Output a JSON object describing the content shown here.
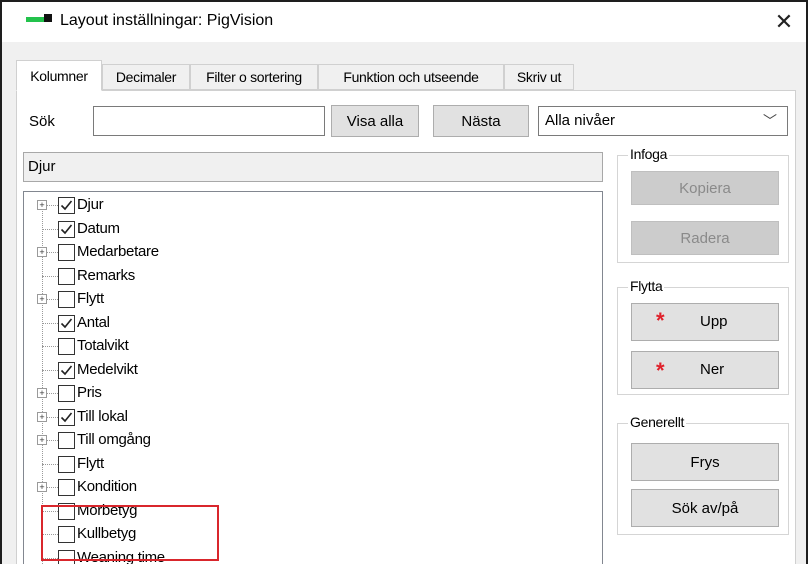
{
  "window": {
    "title": "Layout inställningar: PigVision",
    "close_glyph": "✕"
  },
  "tabs": [
    {
      "label": "Kolumner",
      "active": true
    },
    {
      "label": "Decimaler",
      "active": false
    },
    {
      "label": "Filter o sortering",
      "active": false
    },
    {
      "label": "Funktion och utseende",
      "active": false
    },
    {
      "label": "Skriv ut",
      "active": false
    }
  ],
  "search": {
    "label": "Sök",
    "value": "",
    "show_all_label": "Visa alla",
    "next_label": "Nästa",
    "level_select": "Alla nivåer"
  },
  "path_display": "Djur",
  "tree": {
    "items": [
      {
        "label": "Djur",
        "checked": true,
        "expandable": true
      },
      {
        "label": "Datum",
        "checked": true,
        "expandable": false
      },
      {
        "label": "Medarbetare",
        "checked": false,
        "expandable": true
      },
      {
        "label": "Remarks",
        "checked": false,
        "expandable": false
      },
      {
        "label": "Flytt",
        "checked": false,
        "expandable": true
      },
      {
        "label": "Antal",
        "checked": true,
        "expandable": false
      },
      {
        "label": "Totalvikt",
        "checked": false,
        "expandable": false
      },
      {
        "label": "Medelvikt",
        "checked": true,
        "expandable": false
      },
      {
        "label": "Pris",
        "checked": false,
        "expandable": true
      },
      {
        "label": "Till lokal",
        "checked": true,
        "expandable": true
      },
      {
        "label": "Till omgång",
        "checked": false,
        "expandable": true
      },
      {
        "label": "Flytt",
        "checked": false,
        "expandable": false
      },
      {
        "label": "Kondition",
        "checked": false,
        "expandable": true
      },
      {
        "label": "Morbetyg",
        "checked": false,
        "expandable": false
      },
      {
        "label": "Kullbetyg",
        "checked": false,
        "expandable": false
      },
      {
        "label": "Weaning time",
        "checked": false,
        "expandable": false
      }
    ]
  },
  "infoga": {
    "title": "Infoga",
    "copy_label": "Kopiera",
    "delete_label": "Radera"
  },
  "flytta": {
    "title": "Flytta",
    "up_label": "Upp",
    "down_label": "Ner",
    "star": "*"
  },
  "generellt": {
    "title": "Generellt",
    "freeze_label": "Frys",
    "search_toggle_label": "Sök av/på"
  },
  "colors": {
    "highlight": "#d9262c",
    "star": "#e0202a",
    "icon_green": "#23c24c"
  }
}
